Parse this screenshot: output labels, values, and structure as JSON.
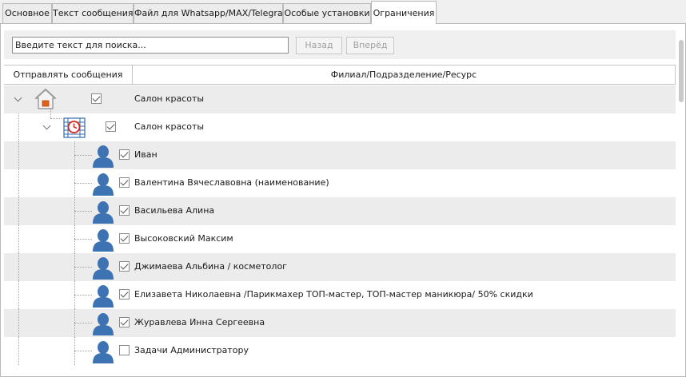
{
  "tabs": [
    {
      "label": "Основное"
    },
    {
      "label": "Текст сообщения"
    },
    {
      "label": "Файл для Whatsapp/MAX/Telegram"
    },
    {
      "label": "Особые установки"
    },
    {
      "label": "Ограничения"
    }
  ],
  "search": {
    "placeholder": "Введите текст для поиска...",
    "back_label": "Назад",
    "forward_label": "Вперёд"
  },
  "columns": {
    "send": "Отправлять сообщения",
    "resource": "Филиал/Подразделение/Ресурс"
  },
  "tree": {
    "root": {
      "label": "Салон красоты",
      "checked": true,
      "expanded": true,
      "icon": "house-icon"
    },
    "branch": {
      "label": "Салон красоты",
      "checked": true,
      "expanded": true,
      "icon": "schedule-icon"
    },
    "resources": [
      {
        "label": "Иван",
        "checked": true
      },
      {
        "label": "Валентина Вячеславовна (наименование)",
        "checked": true
      },
      {
        "label": "Васильева Алина",
        "checked": true
      },
      {
        "label": "Высоковский Максим",
        "checked": true
      },
      {
        "label": "Джимаева Альбина / косметолог",
        "checked": true
      },
      {
        "label": "Елизавета Николаевна /Парикмахер ТОП-мастер, ТОП-мастер маникюра/ 50% скидки",
        "checked": true
      },
      {
        "label": "Журавлева Инна Сергеевна",
        "checked": true
      },
      {
        "label": "Задачи Администратору",
        "checked": false
      }
    ]
  },
  "colors": {
    "person": "#3d73b2",
    "house_roof": "#e0611c",
    "clock": "#d9251a",
    "selected_tab_bg": "#ffffff"
  }
}
